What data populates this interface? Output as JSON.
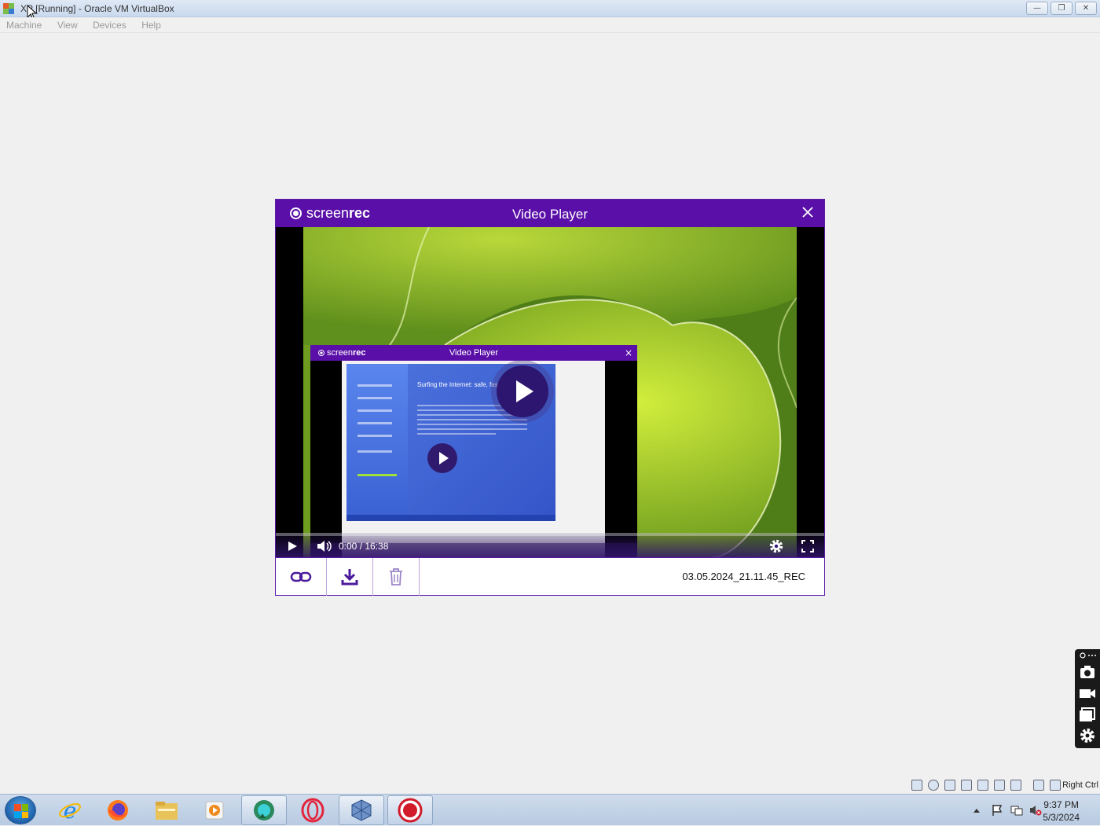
{
  "window": {
    "title": "XP [Running] - Oracle VM VirtualBox",
    "buttons": {
      "minimize": "—",
      "restore": "❐",
      "close": "✕"
    }
  },
  "menu": [
    "Machine",
    "View",
    "Devices",
    "Help"
  ],
  "player": {
    "brand_light": "screen",
    "brand_bold": "rec",
    "title": "Video Player",
    "time": "0:00 / 16:38",
    "progress": 0,
    "filename": "03.05.2024_21.11.45_REC",
    "actions": [
      "copy-link",
      "download",
      "delete"
    ],
    "accent_color": "#5a10a8"
  },
  "nested_player": {
    "brand_light": "screen",
    "brand_bold": "rec",
    "title": "Video Player",
    "close": "×",
    "xp_heading": "Surfing the Internet: safe, fast, and flexible"
  },
  "statusbar": {
    "host_key": "Right Ctrl"
  },
  "taskbar": {
    "items": [
      "internet-explorer",
      "firefox",
      "file-explorer",
      "media-player",
      "screenrec-app",
      "opera",
      "virtualbox",
      "screenrec-recorder"
    ],
    "time": "9:37 PM",
    "date": "5/3/2024"
  }
}
